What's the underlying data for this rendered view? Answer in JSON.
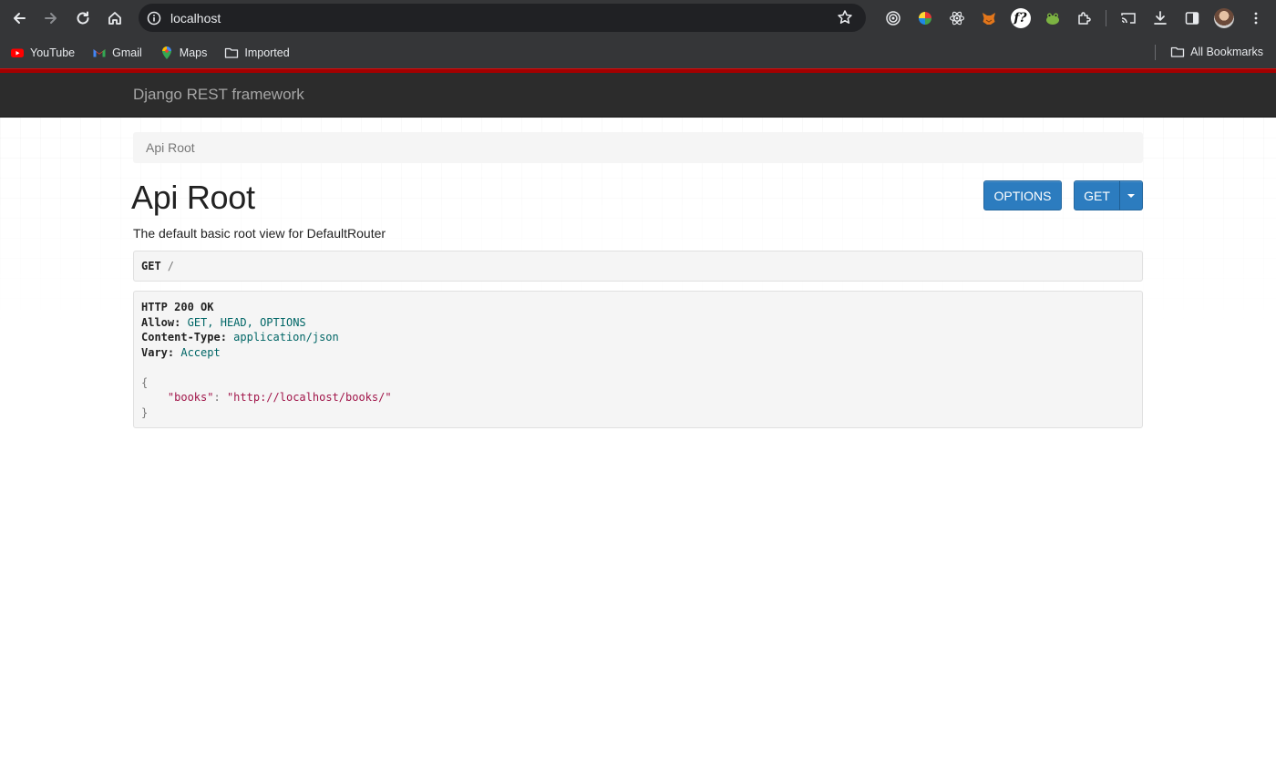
{
  "browser": {
    "url": "localhost",
    "bookmarks": [
      {
        "label": "YouTube",
        "icon": "youtube-icon"
      },
      {
        "label": "Gmail",
        "icon": "gmail-icon"
      },
      {
        "label": "Maps",
        "icon": "maps-icon"
      },
      {
        "label": "Imported",
        "icon": "folder-icon"
      }
    ],
    "all_bookmarks_label": "All Bookmarks",
    "extensions": [
      "target-icon",
      "colorwheel-icon",
      "react-icon",
      "fox-icon",
      "fx-icon",
      "frog-icon",
      "puzzle-icon"
    ],
    "fx_badge_text": "f?"
  },
  "navbar": {
    "brand": "Django REST framework",
    "accent_color": "#a30000",
    "background": "#2c2c2c"
  },
  "breadcrumb": {
    "items": [
      "Api Root"
    ]
  },
  "content": {
    "title": "Api Root",
    "description": "The default basic root view for DefaultRouter",
    "buttons": {
      "options_label": "OPTIONS",
      "get_label": "GET"
    },
    "request": {
      "method": "GET",
      "path": "/"
    },
    "response": {
      "status_line": "HTTP 200 OK",
      "headers": [
        {
          "name": "Allow:",
          "value": "GET, HEAD, OPTIONS"
        },
        {
          "name": "Content-Type:",
          "value": "application/json"
        },
        {
          "name": "Vary:",
          "value": "Accept"
        }
      ],
      "body": {
        "open_brace": "{",
        "key": "\"books\"",
        "colon": ":",
        "value": "\"http://localhost/books/\"",
        "close_brace": "}"
      }
    },
    "button_color": "#2c7cbf"
  }
}
